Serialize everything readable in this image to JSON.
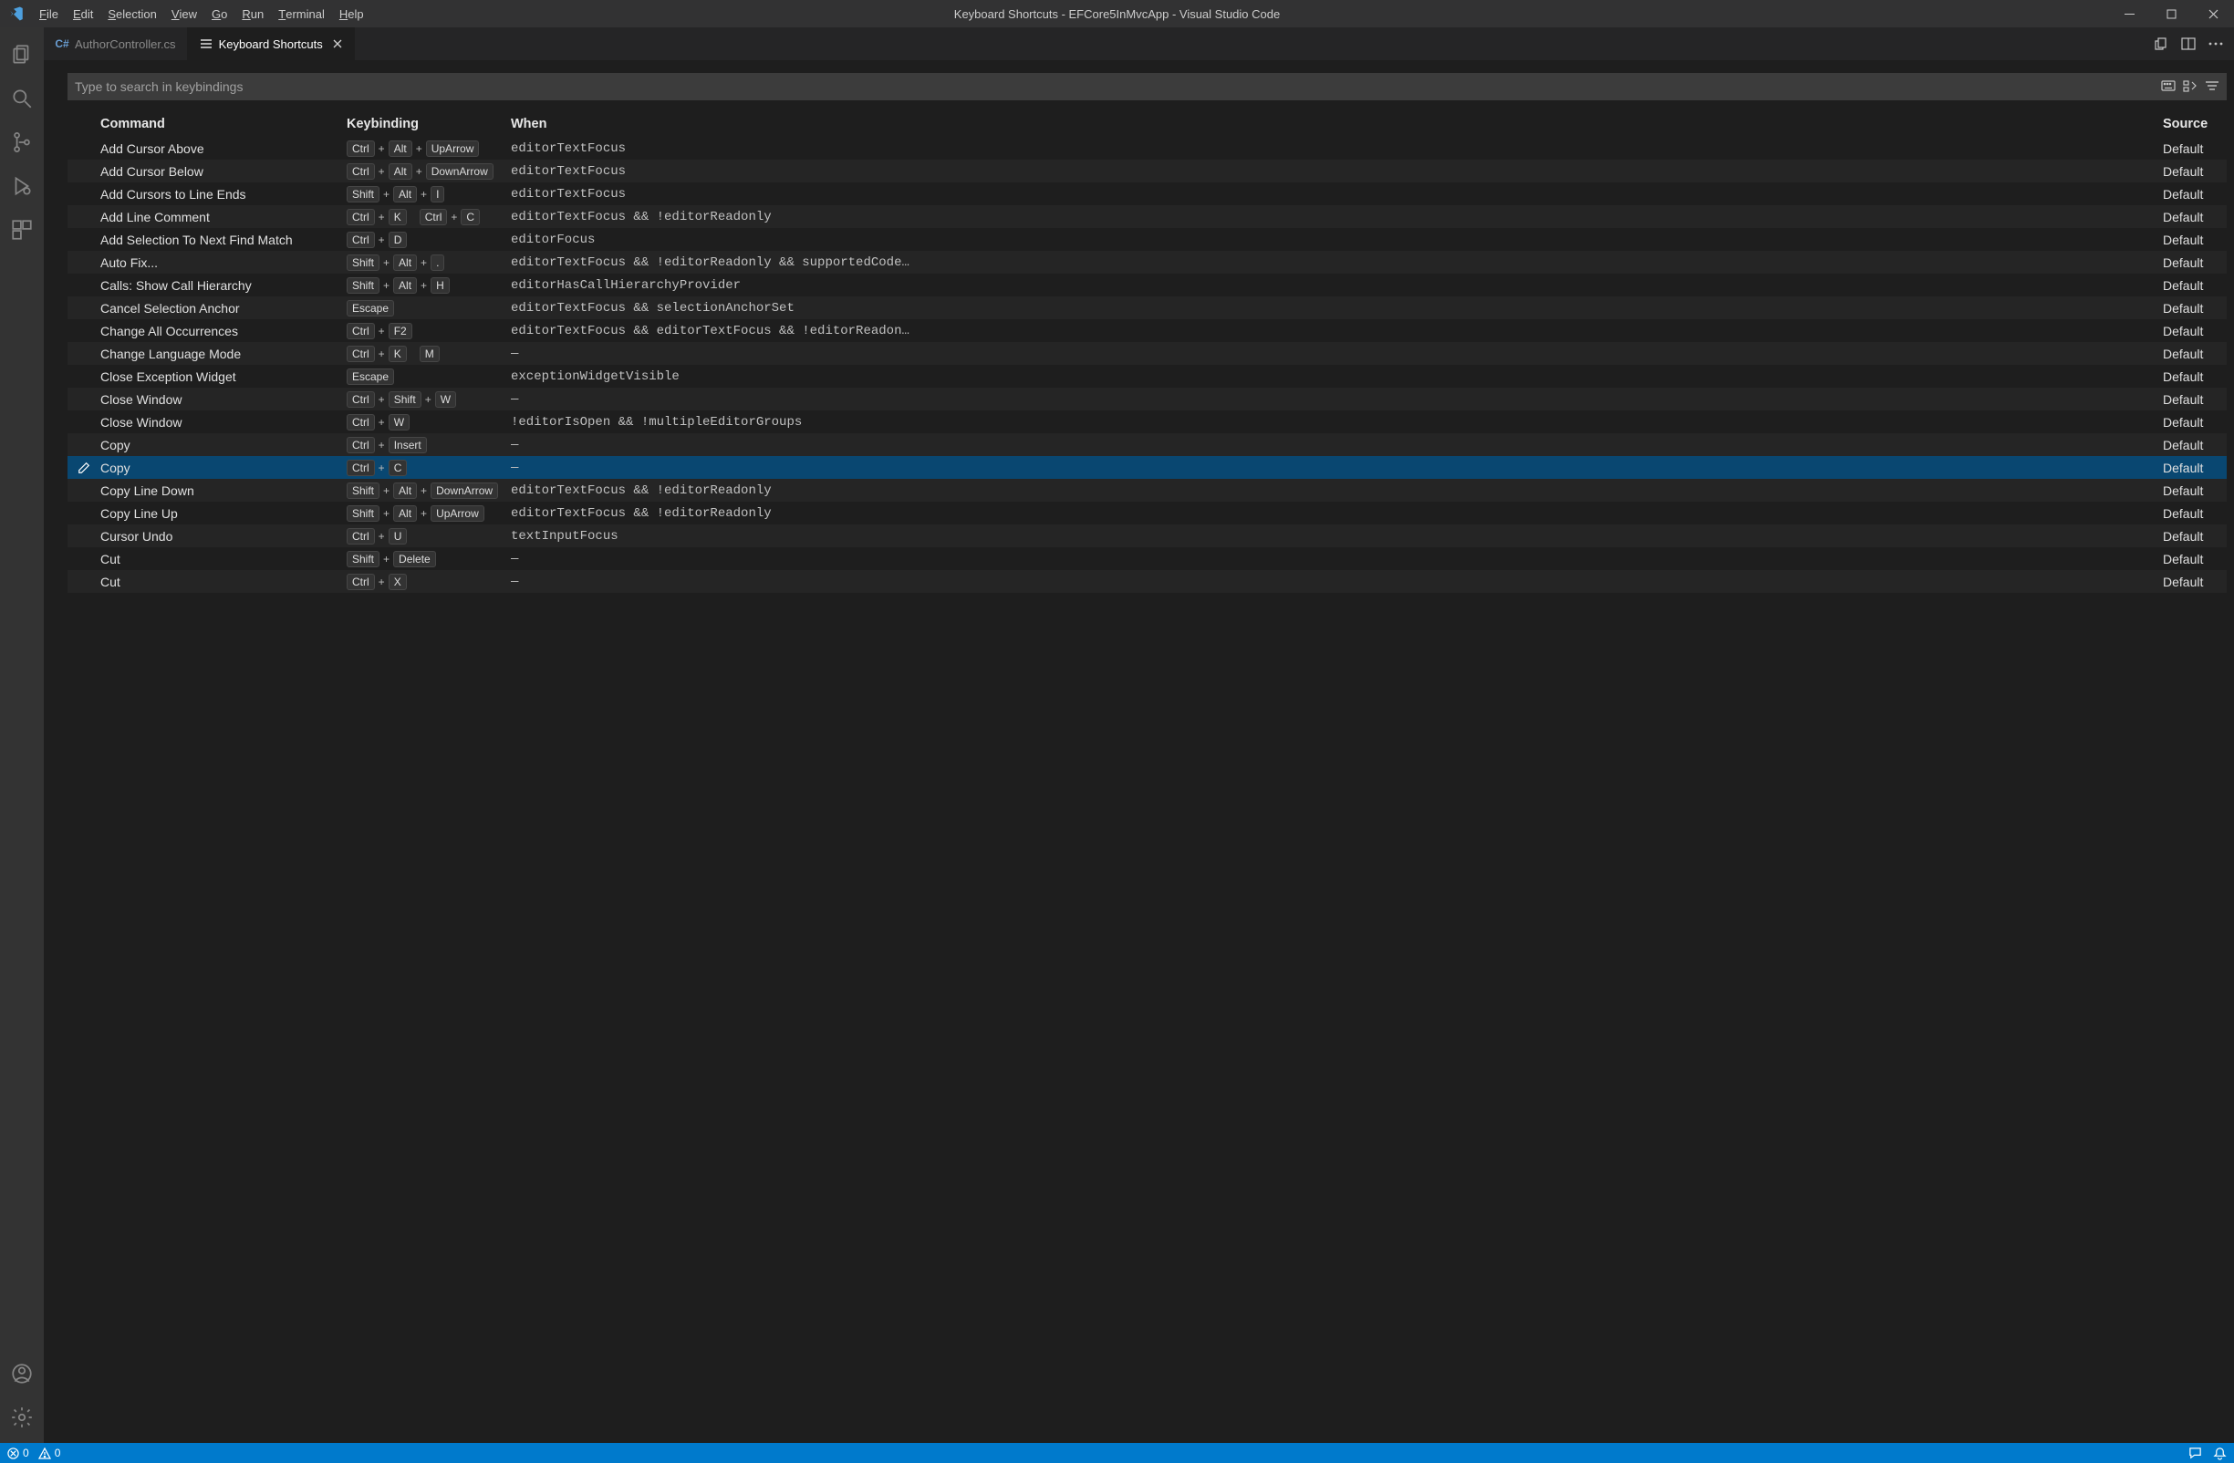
{
  "window": {
    "title": "Keyboard Shortcuts - EFCore5InMvcApp - Visual Studio Code"
  },
  "menu": {
    "items": [
      "File",
      "Edit",
      "Selection",
      "View",
      "Go",
      "Run",
      "Terminal",
      "Help"
    ]
  },
  "tabs": {
    "items": [
      {
        "label": "AuthorController.cs",
        "active": false,
        "icon": "csharp"
      },
      {
        "label": "Keyboard Shortcuts",
        "active": true,
        "icon": "list"
      }
    ]
  },
  "search": {
    "placeholder": "Type to search in keybindings"
  },
  "columns": {
    "command": "Command",
    "keybinding": "Keybinding",
    "when": "When",
    "source": "Source"
  },
  "rows": [
    {
      "command": "Add Cursor Above",
      "keys": [
        [
          "Ctrl",
          "Alt",
          "UpArrow"
        ]
      ],
      "when": "editorTextFocus",
      "source": "Default",
      "selected": false
    },
    {
      "command": "Add Cursor Below",
      "keys": [
        [
          "Ctrl",
          "Alt",
          "DownArrow"
        ]
      ],
      "when": "editorTextFocus",
      "source": "Default",
      "selected": false
    },
    {
      "command": "Add Cursors to Line Ends",
      "keys": [
        [
          "Shift",
          "Alt",
          "I"
        ]
      ],
      "when": "editorTextFocus",
      "source": "Default",
      "selected": false
    },
    {
      "command": "Add Line Comment",
      "keys": [
        [
          "Ctrl",
          "K"
        ],
        [
          "Ctrl",
          "C"
        ]
      ],
      "when": "editorTextFocus && !editorReadonly",
      "source": "Default",
      "selected": false
    },
    {
      "command": "Add Selection To Next Find Match",
      "keys": [
        [
          "Ctrl",
          "D"
        ]
      ],
      "when": "editorFocus",
      "source": "Default",
      "selected": false
    },
    {
      "command": "Auto Fix...",
      "keys": [
        [
          "Shift",
          "Alt",
          "."
        ]
      ],
      "when": "editorTextFocus && !editorReadonly && supportedCode…",
      "source": "Default",
      "selected": false
    },
    {
      "command": "Calls: Show Call Hierarchy",
      "keys": [
        [
          "Shift",
          "Alt",
          "H"
        ]
      ],
      "when": "editorHasCallHierarchyProvider",
      "source": "Default",
      "selected": false
    },
    {
      "command": "Cancel Selection Anchor",
      "keys": [
        [
          "Escape"
        ]
      ],
      "when": "editorTextFocus && selectionAnchorSet",
      "source": "Default",
      "selected": false
    },
    {
      "command": "Change All Occurrences",
      "keys": [
        [
          "Ctrl",
          "F2"
        ]
      ],
      "when": "editorTextFocus && editorTextFocus && !editorReadon…",
      "source": "Default",
      "selected": false
    },
    {
      "command": "Change Language Mode",
      "keys": [
        [
          "Ctrl",
          "K"
        ],
        [
          "M"
        ]
      ],
      "when": "—",
      "source": "Default",
      "selected": false
    },
    {
      "command": "Close Exception Widget",
      "keys": [
        [
          "Escape"
        ]
      ],
      "when": "exceptionWidgetVisible",
      "source": "Default",
      "selected": false
    },
    {
      "command": "Close Window",
      "keys": [
        [
          "Ctrl",
          "Shift",
          "W"
        ]
      ],
      "when": "—",
      "source": "Default",
      "selected": false
    },
    {
      "command": "Close Window",
      "keys": [
        [
          "Ctrl",
          "W"
        ]
      ],
      "when": "!editorIsOpen && !multipleEditorGroups",
      "source": "Default",
      "selected": false
    },
    {
      "command": "Copy",
      "keys": [
        [
          "Ctrl",
          "Insert"
        ]
      ],
      "when": "—",
      "source": "Default",
      "selected": false
    },
    {
      "command": "Copy",
      "keys": [
        [
          "Ctrl",
          "C"
        ]
      ],
      "when": "—",
      "source": "Default",
      "selected": true
    },
    {
      "command": "Copy Line Down",
      "keys": [
        [
          "Shift",
          "Alt",
          "DownArrow"
        ]
      ],
      "when": "editorTextFocus && !editorReadonly",
      "source": "Default",
      "selected": false
    },
    {
      "command": "Copy Line Up",
      "keys": [
        [
          "Shift",
          "Alt",
          "UpArrow"
        ]
      ],
      "when": "editorTextFocus && !editorReadonly",
      "source": "Default",
      "selected": false
    },
    {
      "command": "Cursor Undo",
      "keys": [
        [
          "Ctrl",
          "U"
        ]
      ],
      "when": "textInputFocus",
      "source": "Default",
      "selected": false
    },
    {
      "command": "Cut",
      "keys": [
        [
          "Shift",
          "Delete"
        ]
      ],
      "when": "—",
      "source": "Default",
      "selected": false
    },
    {
      "command": "Cut",
      "keys": [
        [
          "Ctrl",
          "X"
        ]
      ],
      "when": "—",
      "source": "Default",
      "selected": false
    }
  ],
  "status": {
    "errors": "0",
    "warnings": "0"
  }
}
